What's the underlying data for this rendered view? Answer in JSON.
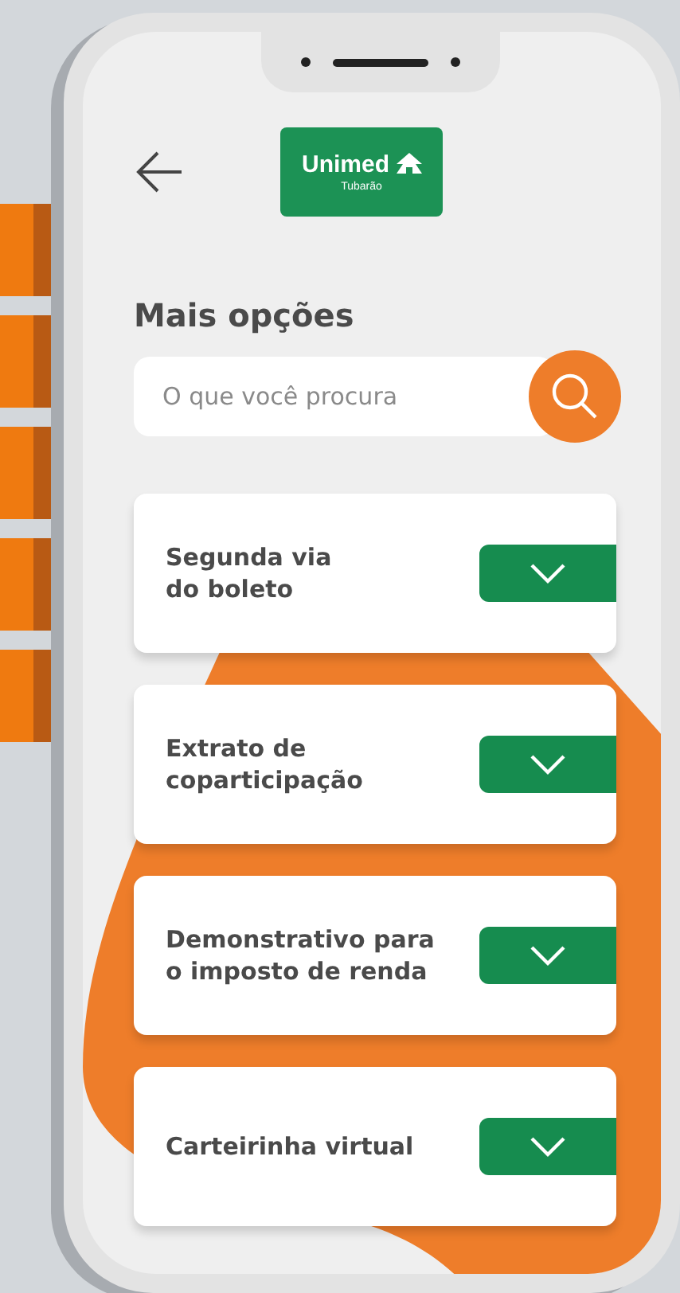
{
  "header": {
    "logo": {
      "name": "Unimed",
      "subtitle": "Tubarão"
    }
  },
  "title": "Mais opções",
  "search": {
    "placeholder": "O que você procura"
  },
  "options": [
    {
      "lines": [
        "Segunda via",
        "do boleto"
      ],
      "expanded": false
    },
    {
      "lines": [
        "Extrato de",
        "coparticipação"
      ],
      "expanded": false
    },
    {
      "lines": [
        "Demonstrativo para",
        "o imposto de renda"
      ],
      "expanded": false
    },
    {
      "lines": [
        "Carteirinha virtual"
      ],
      "expanded": false
    }
  ]
}
